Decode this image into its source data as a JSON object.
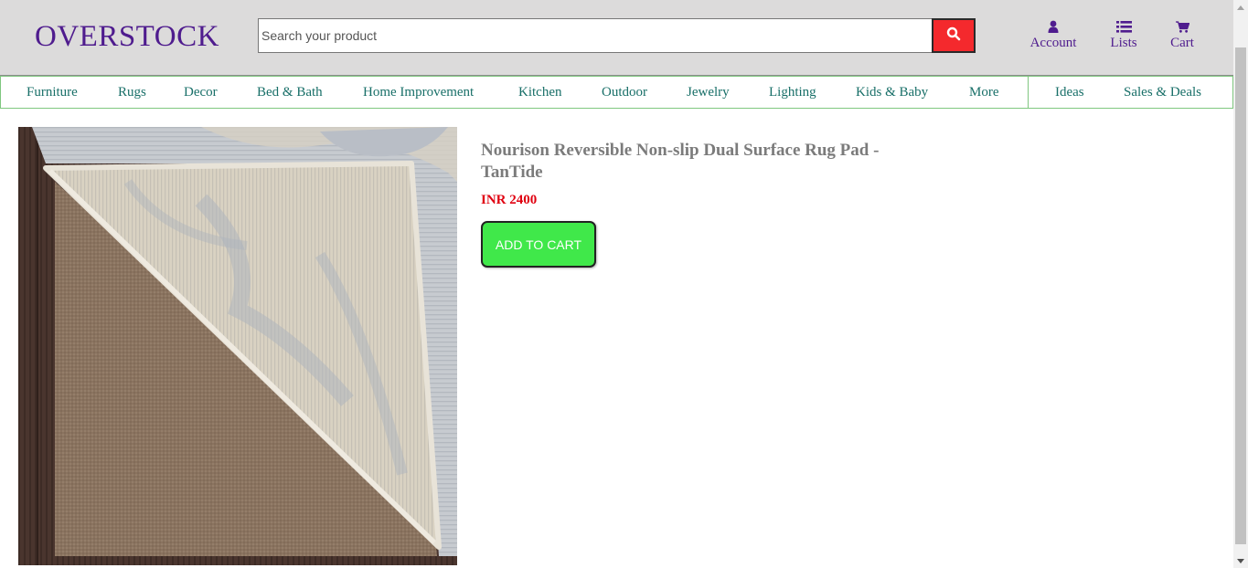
{
  "header": {
    "logo": "OVERSTOCK",
    "search_placeholder": "Search your product",
    "links": [
      {
        "label": "Account",
        "icon": "user-icon"
      },
      {
        "label": "Lists",
        "icon": "list-icon"
      },
      {
        "label": "Cart",
        "icon": "cart-icon"
      }
    ]
  },
  "nav": {
    "items": [
      "Furniture",
      "Rugs",
      "Decor",
      "Bed & Bath",
      "Home Improvement",
      "Kitchen",
      "Outdoor",
      "Jewelry",
      "Lighting",
      "Kids & Baby",
      "More",
      "Ideas",
      "Sales & Deals"
    ]
  },
  "product": {
    "title": "Nourison Reversible Non-slip Dual Surface Rug Pad - TanTide",
    "price": "INR 2400",
    "add_to_cart": "ADD TO CART"
  },
  "colors": {
    "brand": "#4f1c8e",
    "nav_text": "#186f68",
    "search_button": "#f4292d",
    "price": "#e00010",
    "cart_button": "#40e84a",
    "header_bg": "#dcdbdb"
  }
}
